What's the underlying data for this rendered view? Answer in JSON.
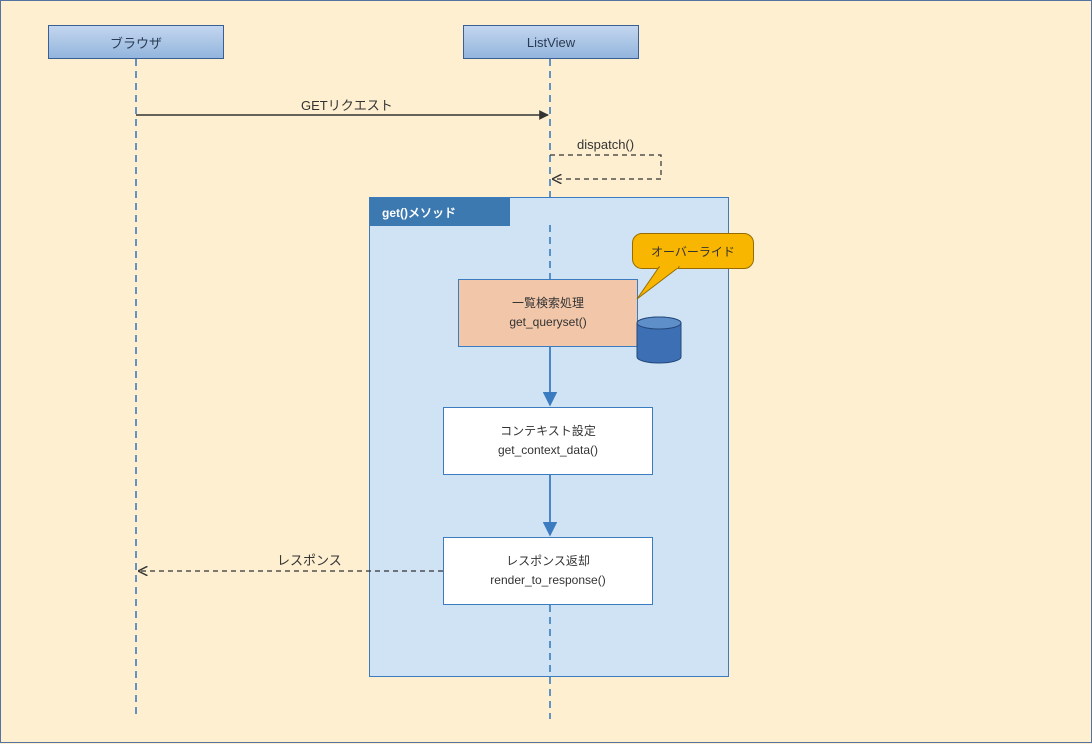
{
  "participants": {
    "browser": "ブラウザ",
    "listview": "ListView"
  },
  "messages": {
    "request": "GETリクエスト",
    "dispatch": "dispatch()",
    "response": "レスポンス"
  },
  "frame": {
    "title": "get()メソッド"
  },
  "steps": {
    "queryset_title": "一覧検索処理",
    "queryset_method": "get_queryset()",
    "context_title": "コンテキスト設定",
    "context_method": "get_context_data()",
    "render_title": "レスポンス返却",
    "render_method": "render_to_response()"
  },
  "callout": {
    "label": "オーバーライド"
  }
}
